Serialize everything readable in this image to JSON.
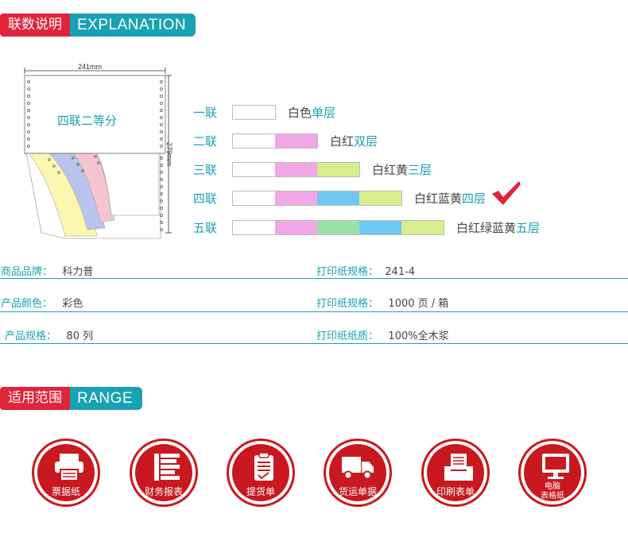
{
  "explanation_header": {
    "cn": "联数说明",
    "en": "EXPLANATION"
  },
  "diagram": {
    "width_label": "241mm",
    "height_label": "279mm",
    "sheet_text": "四联二等分"
  },
  "plies": [
    {
      "label": "一联",
      "colors": [
        "#ffffff"
      ],
      "desc_plain": "白色",
      "desc_accent": "单层",
      "checked": false
    },
    {
      "label": "二联",
      "colors": [
        "#ffffff",
        "#f2a7e6"
      ],
      "desc_plain": "白红",
      "desc_accent": "双层",
      "checked": false
    },
    {
      "label": "三联",
      "colors": [
        "#ffffff",
        "#f2a7e6",
        "#d6ef8c"
      ],
      "desc_plain": "白红黄",
      "desc_accent": "三层",
      "checked": false
    },
    {
      "label": "四联",
      "colors": [
        "#ffffff",
        "#f2a7e6",
        "#6fc7f2",
        "#d6ef8c"
      ],
      "desc_plain": "白红蓝黄",
      "desc_accent": "四层",
      "checked": true
    },
    {
      "label": "五联",
      "colors": [
        "#ffffff",
        "#f2a7e6",
        "#9ae2a6",
        "#6fc7f2",
        "#d6ef8c"
      ],
      "desc_plain": "白红绿蓝黄",
      "desc_accent": "五层",
      "checked": false
    }
  ],
  "specs": {
    "brand_key": "商品品牌：",
    "brand_val": "科力普",
    "size_key": "打印纸规格：",
    "size_val": "241-4",
    "color_key": "产品颜色：",
    "color_val": "彩色",
    "qty_key": "打印纸规格：",
    "qty_val": "1000 页 / 箱",
    "spec_key": "产品规格：",
    "spec_val": "80 列",
    "material_key": "打印纸纸质：",
    "material_val": "100%全木浆"
  },
  "range_header": {
    "cn": "适用范围",
    "en": "RANGE"
  },
  "uses": [
    {
      "label": "票据纸",
      "icon": "printer-icon"
    },
    {
      "label": "财务报表",
      "icon": "report-icon"
    },
    {
      "label": "提货单",
      "icon": "clipboard-icon"
    },
    {
      "label": "货运单据",
      "icon": "truck-icon"
    },
    {
      "label": "印刷表单",
      "icon": "tray-icon"
    },
    {
      "label_line1": "电脑",
      "label_line2": "表格纸",
      "icon": "monitor-icon"
    }
  ],
  "colors": {
    "red": "#e0243a",
    "teal": "#19a2b4",
    "icon_red": "#c9181f"
  }
}
